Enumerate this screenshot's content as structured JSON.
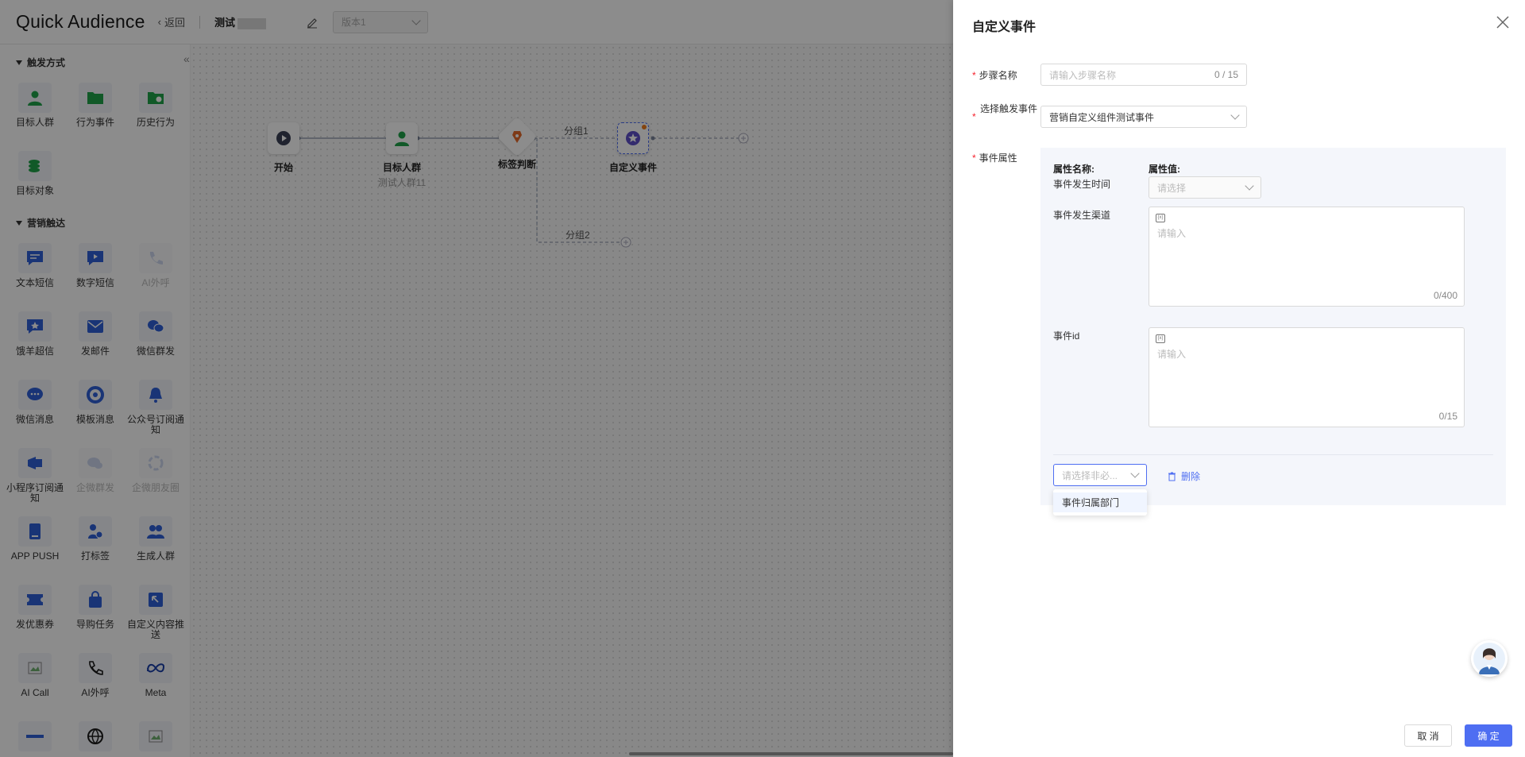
{
  "header": {
    "logo": "Quick Audience",
    "back": "返回",
    "flow_name": "测试",
    "version_placeholder": "版本1"
  },
  "sidebar": {
    "section_trigger": "触发方式",
    "section_marketing": "营销触达",
    "trigger_tools": [
      {
        "label": "目标人群",
        "icon": "person-icon"
      },
      {
        "label": "行为事件",
        "icon": "folder-icon"
      },
      {
        "label": "历史行为",
        "icon": "history-folder-icon"
      },
      {
        "label": "目标对象",
        "icon": "target-object-icon"
      }
    ],
    "marketing_tools": [
      {
        "label": "文本短信",
        "icon": "sms-icon"
      },
      {
        "label": "数字短信",
        "icon": "digital-sms-icon"
      },
      {
        "label": "AI外呼",
        "icon": "ai-call-icon"
      },
      {
        "label": "饿羊超信",
        "icon": "super-sms-icon"
      },
      {
        "label": "发邮件",
        "icon": "mail-icon"
      },
      {
        "label": "微信群发",
        "icon": "wechat-icon"
      },
      {
        "label": "微信消息",
        "icon": "message-icon"
      },
      {
        "label": "模板消息",
        "icon": "template-icon"
      },
      {
        "label": "公众号订阅通知",
        "icon": "bell-icon"
      },
      {
        "label": "小程序订阅通知",
        "icon": "miniapp-icon"
      },
      {
        "label": "企微群发",
        "icon": "wecom-group-icon"
      },
      {
        "label": "企微朋友圈",
        "icon": "wecom-moments-icon"
      },
      {
        "label": "APP PUSH",
        "icon": "phone-icon"
      },
      {
        "label": "打标签",
        "icon": "tag-icon"
      },
      {
        "label": "生成人群",
        "icon": "group-icon"
      },
      {
        "label": "发优惠券",
        "icon": "coupon-icon"
      },
      {
        "label": "导购任务",
        "icon": "shopping-bag-icon"
      },
      {
        "label": "自定义内容推送",
        "icon": "custom-push-icon"
      },
      {
        "label": "AI Call",
        "icon": "broken-image-icon"
      },
      {
        "label": "AI外呼",
        "icon": "phone-call-icon"
      },
      {
        "label": "Meta",
        "icon": "meta-icon"
      }
    ]
  },
  "canvas": {
    "nodes": [
      {
        "name": "开始",
        "sub": ""
      },
      {
        "name": "目标人群",
        "sub": "测试人群11"
      },
      {
        "name": "标签判断",
        "sub": ""
      },
      {
        "name": "自定义事件",
        "sub": ""
      }
    ],
    "branch1": "分组1",
    "branch2": "分组2"
  },
  "drawer": {
    "title": "自定义事件",
    "step_name_label": "步骤名称",
    "step_name_placeholder": "请输入步骤名称",
    "step_name_count": "0 / 15",
    "trigger_event_label": "选择触发事件",
    "trigger_event_value": "营销自定义组件测试事件",
    "event_attr_label": "事件属性",
    "attr_name_header": "属性名称:",
    "attr_value_header": "属性值:",
    "attr_time": "事件发生时间",
    "attr_time_placeholder": "请选择",
    "attr_channel": "事件发生渠道",
    "attr_channel_placeholder": "请输入",
    "attr_channel_count": "0/400",
    "attr_id": "事件id",
    "attr_id_placeholder": "请输入",
    "attr_id_count": "0/15",
    "optional_select_placeholder": "请选择非必...",
    "delete_label": "删除",
    "dropdown_option": "事件归属部门",
    "cancel": "取 消",
    "confirm": "确 定"
  }
}
